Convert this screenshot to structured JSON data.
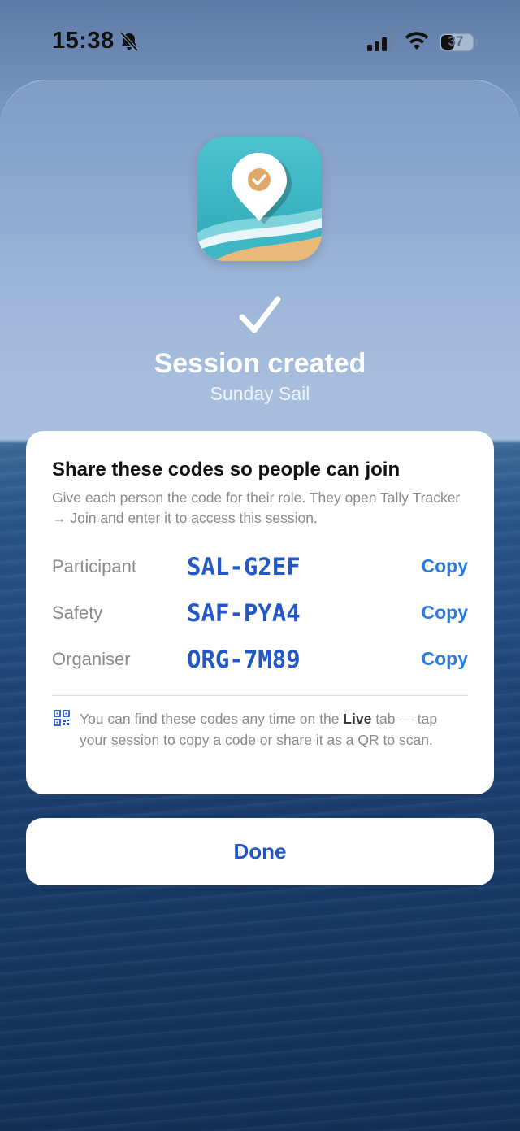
{
  "status_bar": {
    "time": "15:38",
    "battery": "37"
  },
  "header": {
    "title": "Session created",
    "session_name": "Sunday Sail"
  },
  "card": {
    "heading": "Share these codes so people can join",
    "description": "Give each person the code for their role. They open Tally Tracker → Join and enter it to access this session.",
    "copy_label": "Copy",
    "codes": [
      {
        "role": "Participant",
        "code": "SAL-G2EF"
      },
      {
        "role": "Safety",
        "code": "SAF-PYA4"
      },
      {
        "role": "Organiser",
        "code": "ORG-7M89"
      }
    ],
    "info_prefix": "You can find these codes any time on the ",
    "info_bold": "Live",
    "info_suffix": " tab — tap your session to copy a code or share it as a QR to scan."
  },
  "done_label": "Done",
  "colors": {
    "accent": "#2257c5",
    "copy": "#2a7be0"
  }
}
